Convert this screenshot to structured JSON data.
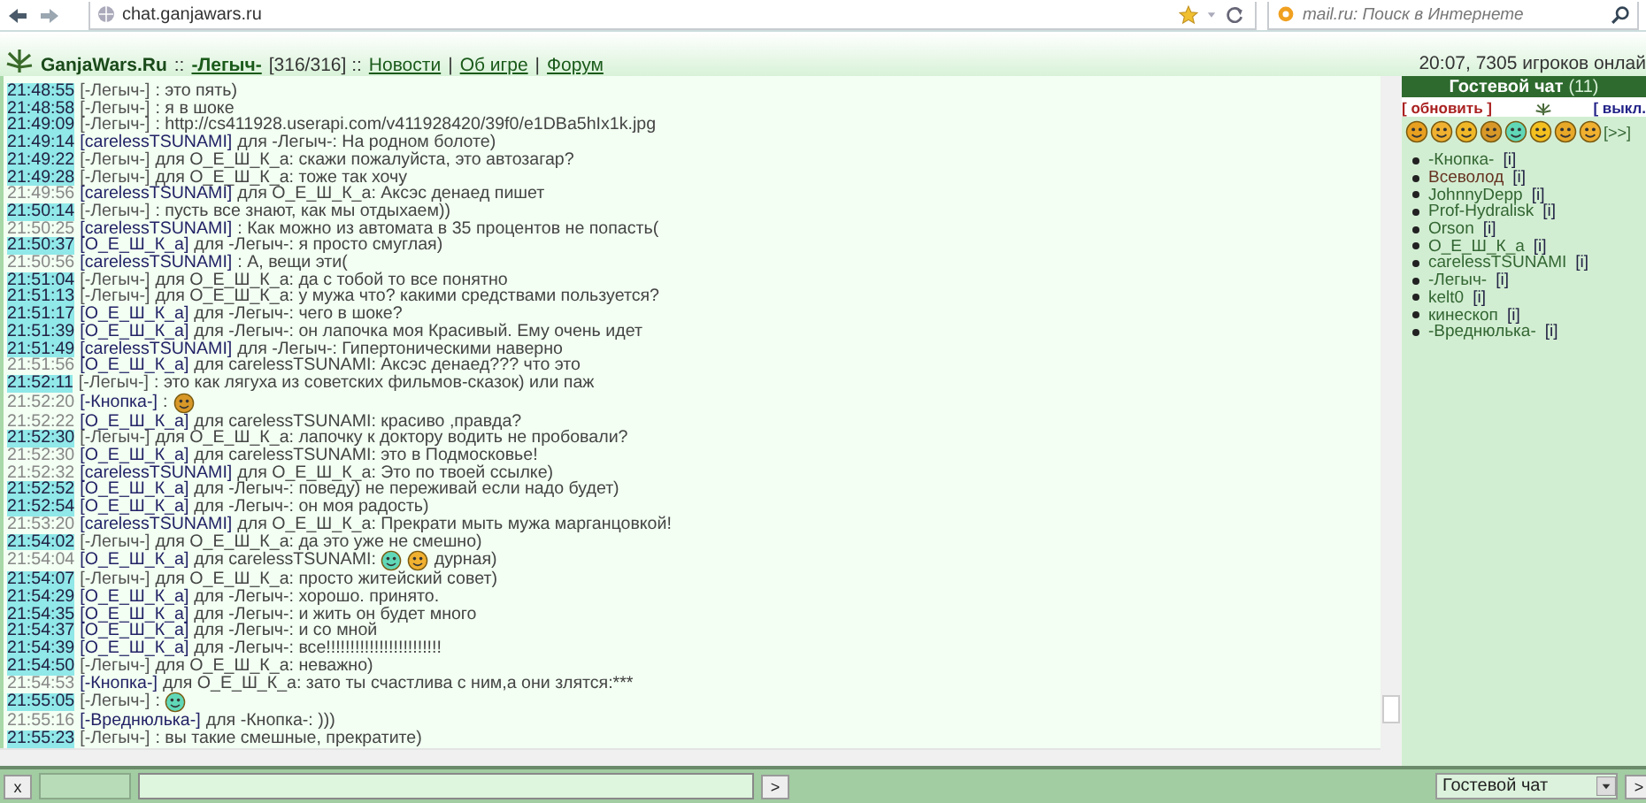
{
  "browser": {
    "url": "chat.ganjawars.ru",
    "search_placeholder": "mail.ru: Поиск в Интернете"
  },
  "header": {
    "site": "GanjaWars.Ru",
    "sep": "::",
    "user": "-Легыч-",
    "hp": "[316/316] ::",
    "links": [
      {
        "label": "Новости"
      },
      {
        "label": "Об игре",
        "sep": "|"
      },
      {
        "label": "Форум",
        "sep": "|"
      }
    ],
    "status": "20:07, 7305 игроков онлай"
  },
  "messages": [
    {
      "time": "21:48:55",
      "highlighted": true,
      "from": "[-Легыч-]",
      "nick": false,
      "text": ": это пять)"
    },
    {
      "time": "21:48:58",
      "highlighted": true,
      "from": "[-Легыч-]",
      "nick": false,
      "text": ": я в шоке"
    },
    {
      "time": "21:49:09",
      "highlighted": true,
      "from": "[-Легыч-]",
      "nick": false,
      "text": ": http://cs411928.userapi.com/v411928420/39f0/e1DBa5hIx1k.jpg"
    },
    {
      "time": "21:49:14",
      "highlighted": true,
      "from": "[carelessTSUNAMI]",
      "nick": true,
      "text": "для -Легыч-: На родном болоте)"
    },
    {
      "time": "21:49:22",
      "highlighted": true,
      "from": "[-Легыч-]",
      "nick": false,
      "text": "для О_Е_Ш_К_а: скажи пожалуйста, это автозагар?"
    },
    {
      "time": "21:49:28",
      "highlighted": true,
      "from": "[-Легыч-]",
      "nick": false,
      "text": "для О_Е_Ш_К_а: тоже так хочу"
    },
    {
      "time": "21:49:56",
      "highlighted": false,
      "from": "[carelessTSUNAMI]",
      "nick": true,
      "text": "для О_Е_Ш_К_а: Аксэс денаед пишет"
    },
    {
      "time": "21:50:14",
      "highlighted": true,
      "from": "[-Легыч-]",
      "nick": false,
      "text": ": пусть все знают, как мы отдыхаем))"
    },
    {
      "time": "21:50:25",
      "highlighted": false,
      "from": "[carelessTSUNAMI]",
      "nick": true,
      "text": ": Как можно из автомата в 35 процентов не попасть("
    },
    {
      "time": "21:50:37",
      "highlighted": true,
      "from": "[О_Е_Ш_К_а]",
      "nick": true,
      "text": "для -Легыч-: я просто смуглая)"
    },
    {
      "time": "21:50:56",
      "highlighted": false,
      "from": "[carelessTSUNAMI]",
      "nick": true,
      "text": ": А, вещи эти("
    },
    {
      "time": "21:51:04",
      "highlighted": true,
      "from": "[-Легыч-]",
      "nick": false,
      "text": "для О_Е_Ш_К_а: да с тобой то все понятно"
    },
    {
      "time": "21:51:13",
      "highlighted": true,
      "from": "[-Легыч-]",
      "nick": false,
      "text": "для О_Е_Ш_К_а: у мужа что? какими средствами пользуется?"
    },
    {
      "time": "21:51:17",
      "highlighted": true,
      "from": "[О_Е_Ш_К_а]",
      "nick": true,
      "text": "для -Легыч-: чего в шоке?"
    },
    {
      "time": "21:51:39",
      "highlighted": true,
      "from": "[О_Е_Ш_К_а]",
      "nick": true,
      "text": "для -Легыч-: он лапочка моя Красивый. Ему очень идет"
    },
    {
      "time": "21:51:49",
      "highlighted": true,
      "from": "[carelessTSUNAMI]",
      "nick": true,
      "text": "для -Легыч-: Гипертоническими наверно"
    },
    {
      "time": "21:51:56",
      "highlighted": false,
      "from": "[О_Е_Ш_К_а]",
      "nick": true,
      "text": "для carelessTSUNAMI: Аксэс денаед??? что это"
    },
    {
      "time": "21:52:11",
      "highlighted": true,
      "from": "[-Легыч-]",
      "nick": false,
      "text": ": это как лягуха из советских фильмов-сказок) или паж"
    },
    {
      "time": "21:52:20",
      "highlighted": false,
      "from": "[-Кнопка-]",
      "nick": true,
      "text": ":",
      "smileys": [
        {
          "kind": "angry"
        }
      ]
    },
    {
      "time": "21:52:22",
      "highlighted": false,
      "from": "[О_Е_Ш_К_а]",
      "nick": true,
      "text": "для carelessTSUNAMI: красиво ,правда?"
    },
    {
      "time": "21:52:30",
      "highlighted": true,
      "from": "[-Легыч-]",
      "nick": false,
      "text": "для О_Е_Ш_К_а: лапочку к доктору водить не пробовали?"
    },
    {
      "time": "21:52:30",
      "highlighted": false,
      "from": "[О_Е_Ш_К_а]",
      "nick": true,
      "text": "для carelessTSUNAMI: это в Подмосковье!"
    },
    {
      "time": "21:52:32",
      "highlighted": false,
      "from": "[carelessTSUNAMI]",
      "nick": true,
      "text": "для О_Е_Ш_К_а: Это по твоей ссылке)"
    },
    {
      "time": "21:52:52",
      "highlighted": true,
      "from": "[О_Е_Ш_К_а]",
      "nick": true,
      "text": "для -Легыч-: поведу) не переживай если надо будет)"
    },
    {
      "time": "21:52:54",
      "highlighted": true,
      "from": "[О_Е_Ш_К_а]",
      "nick": true,
      "text": "для -Легыч-: он моя радость)"
    },
    {
      "time": "21:53:20",
      "highlighted": false,
      "from": "[carelessTSUNAMI]",
      "nick": true,
      "text": "для О_Е_Ш_К_а: Прекрати мыть мужа марганцовкой!"
    },
    {
      "time": "21:54:02",
      "highlighted": true,
      "from": "[-Легыч-]",
      "nick": false,
      "text": "для О_Е_Ш_К_а: да это уже не смешно)"
    },
    {
      "time": "21:54:04",
      "highlighted": false,
      "from": "[О_Е_Ш_К_а]",
      "nick": true,
      "text": "для carelessTSUNAMI:",
      "smileys": [
        {
          "kind": "green"
        },
        {
          "kind": "laugh"
        }
      ],
      "after": "дурная)"
    },
    {
      "time": "21:54:07",
      "highlighted": true,
      "from": "[-Легыч-]",
      "nick": false,
      "text": "для О_Е_Ш_К_а: просто житейский совет)"
    },
    {
      "time": "21:54:29",
      "highlighted": true,
      "from": "[О_Е_Ш_К_а]",
      "nick": true,
      "text": "для -Легыч-: хорошо. принято."
    },
    {
      "time": "21:54:35",
      "highlighted": true,
      "from": "[О_Е_Ш_К_а]",
      "nick": true,
      "text": "для -Легыч-: и жить он будет много"
    },
    {
      "time": "21:54:37",
      "highlighted": true,
      "from": "[О_Е_Ш_К_а]",
      "nick": true,
      "text": "для -Легыч-: и со мной"
    },
    {
      "time": "21:54:39",
      "highlighted": true,
      "from": "[О_Е_Ш_К_а]",
      "nick": true,
      "text": "для -Легыч-: все!!!!!!!!!!!!!!!!!!!!!!!!"
    },
    {
      "time": "21:54:50",
      "highlighted": true,
      "from": "[-Легыч-]",
      "nick": false,
      "text": "для О_Е_Ш_К_а: неважно)"
    },
    {
      "time": "21:54:53",
      "highlighted": false,
      "from": "[-Кнопка-]",
      "nick": true,
      "text": "для О_Е_Ш_К_а: зато ты счастлива с ним,а они злятся:***"
    },
    {
      "time": "21:55:05",
      "highlighted": true,
      "from": "[-Легыч-]",
      "nick": false,
      "text": ":",
      "smileys": [
        {
          "kind": "green"
        }
      ]
    },
    {
      "time": "21:55:16",
      "highlighted": false,
      "from": "[-Вреднюлька-]",
      "nick": true,
      "text": "для -Кнопка-: )))"
    },
    {
      "time": "21:55:23",
      "highlighted": true,
      "from": "[-Легыч-]",
      "nick": false,
      "text": ": вы такие смешные, прекратите)"
    }
  ],
  "panel": {
    "title": "Гостевой чат",
    "count": "(11)",
    "refresh": "[ обновить ]",
    "off": "[ выкл.",
    "smileys": [
      {
        "kind": "cool"
      },
      {
        "kind": "laugh"
      },
      {
        "kind": "smile"
      },
      {
        "kind": "angry"
      },
      {
        "kind": "green"
      },
      {
        "kind": "plain"
      },
      {
        "kind": "wink"
      },
      {
        "kind": "tongue"
      }
    ],
    "more": "[>>]",
    "users": [
      {
        "name": "-Кнопка-",
        "color": "#336633",
        "info": "[i]"
      },
      {
        "name": "Всеволод",
        "color": "#663322",
        "info": "[i]"
      },
      {
        "name": "JohnnyDepp",
        "color": "#336633",
        "info": "[i]"
      },
      {
        "name": "Prof-Hydralisk",
        "color": "#336633",
        "info": "[i]"
      },
      {
        "name": "Orson",
        "color": "#336633",
        "info": "[i]"
      },
      {
        "name": "О_Е_Ш_К_а",
        "color": "#336633",
        "info": "[i]"
      },
      {
        "name": "carelessTSUNAMI",
        "color": "#336633",
        "info": "[i]"
      },
      {
        "name": "-Легыч-",
        "color": "#336633",
        "info": "[i]"
      },
      {
        "name": "kelt0",
        "color": "#336633",
        "info": "[i]"
      },
      {
        "name": "кинескоп",
        "color": "#336633",
        "info": "[i]"
      },
      {
        "name": "-Вреднюлька-",
        "color": "#336633",
        "info": "[i]"
      }
    ]
  },
  "bottom": {
    "clear": "x",
    "send": ">",
    "channel": "Гостевой чат",
    "send2": ">"
  }
}
